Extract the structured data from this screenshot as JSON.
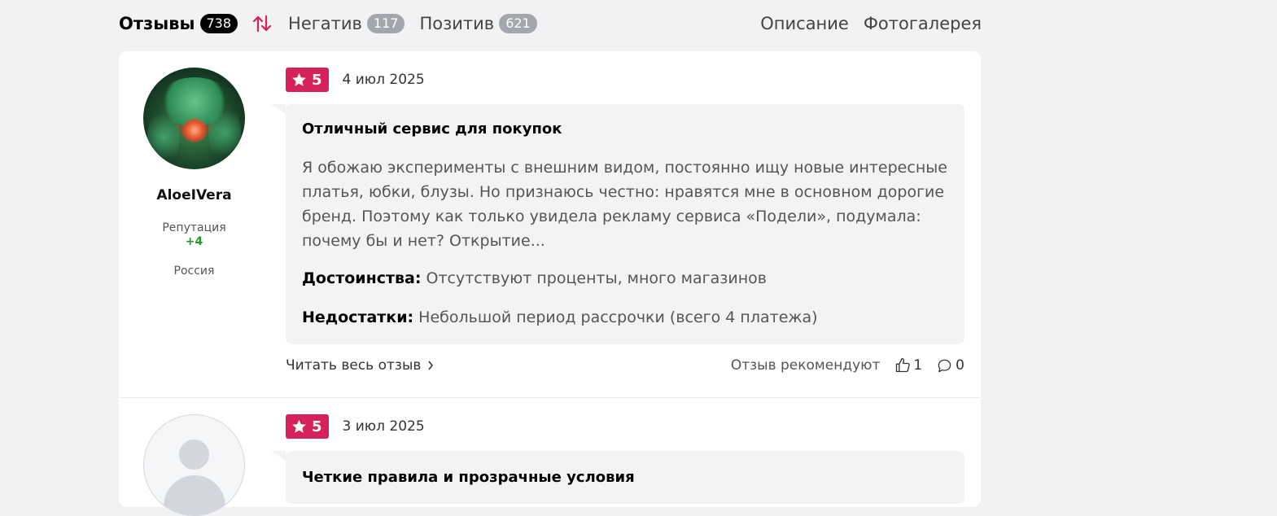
{
  "tabs": {
    "reviews": {
      "label": "Отзывы",
      "count": "738"
    },
    "negative": {
      "label": "Негатив",
      "count": "117"
    },
    "positive": {
      "label": "Позитив",
      "count": "621"
    },
    "description": "Описание",
    "gallery": "Фотогалерея"
  },
  "icons": {
    "sort": "sort-arrows-icon",
    "star": "star-icon",
    "chevron": "chevron-right-icon",
    "like": "thumbs-up-icon",
    "comment": "comment-bubble-icon",
    "avatar_placeholder": "user-placeholder-icon"
  },
  "colors": {
    "accent": "#d6215a",
    "rep_positive": "#1d9a2b"
  },
  "reviews": [
    {
      "author": "AloeIVera",
      "reputation_label": "Репутация",
      "reputation": "+4",
      "location": "Россия",
      "rating": "5",
      "date": "4 июл 2025",
      "title": "Отличный сервис для покупок",
      "text": "Я обожаю эксперименты с внешним видом, постоянно ищу новые интересные платья, юбки, блузы. Но признаюсь честно: нравятся мне в основном дорогие бренд. Поэтому как только увидела рекламу сервиса «Подели», подумала: почему бы и нет? Открытие...",
      "pros_label": "Достоинства:",
      "pros": "Отсутствуют проценты, много магазинов",
      "cons_label": "Недостатки:",
      "cons": "Небольшой период рассрочки (всего 4 платежа)",
      "read_more": "Читать весь отзыв",
      "recommend": "Отзыв рекомендуют",
      "likes": "1",
      "comments": "0"
    },
    {
      "rating": "5",
      "date": "3 июл 2025",
      "title": "Четкие правила и прозрачные условия"
    }
  ]
}
